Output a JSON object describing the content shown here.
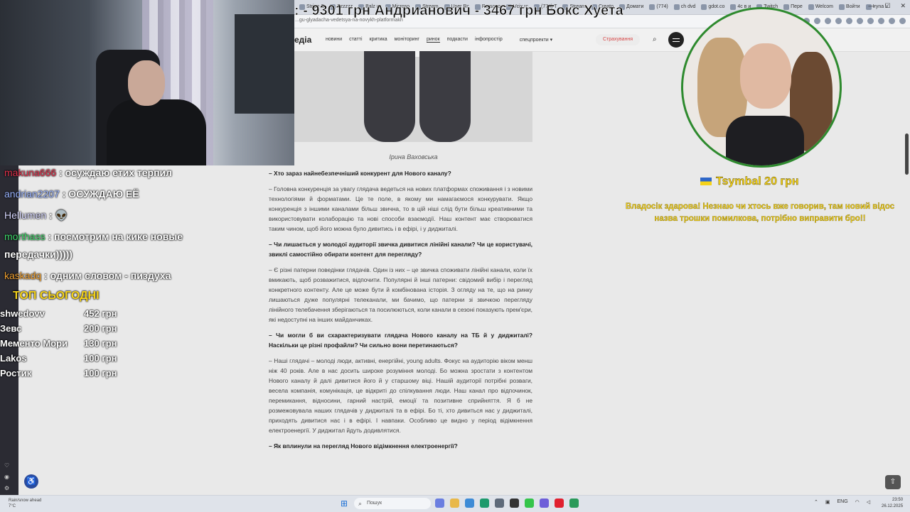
{
  "browser": {
    "tabs": [
      "Stripe C",
      "Zzzzzz",
      "Balz и",
      "Microso",
      "Stream",
      "User Rc",
      "Persono",
      "Vcix rc",
      "(774) T",
      "Stream",
      "Creato",
      "Домати",
      "(774)",
      "ch dvd",
      "gdot.co",
      "4с в и",
      "Twitch",
      "Пере",
      "Welcom",
      "Войти",
      "Iryna V"
    ],
    "url": "...gu-glyadacha-vedetsya-na-novykh-platformakh"
  },
  "site": {
    "logo": "едіа",
    "nav": [
      "новини",
      "статті",
      "критика",
      "моніторинг",
      "ринок",
      "подкасти",
      "інфопростір",
      "спецпроекти ▾"
    ],
    "active_nav": "ринок",
    "insurance_label": "Страхування",
    "search_icon": "⌕"
  },
  "article": {
    "caption": "Ірина Ваховська",
    "paragraphs": [
      {
        "type": "q",
        "text": "– Хто зараз найнебезпечніший конкурент для Нового каналу?"
      },
      {
        "type": "a",
        "text": "– Головна конкуренція за увагу глядача ведеться на нових платформах споживання і з новими технологіями й форматами. Це те поле, в якому ми намагаємося конкурувати. Якщо конкуренція з іншими каналами більш звична, то в цій ніші слід бути більш креативними та використовувати колаборацію та нові способи взаємодії. Наш контент має створюватися таким чином, щоб його можна було дивитись і в ефірі, і у диджиталі."
      },
      {
        "type": "q",
        "text": "– Чи лишається у молодої аудиторії звичка дивитися лінійні канали? Чи це користувачі, звиклі самостійно обирати контент для перегляду?"
      },
      {
        "type": "a",
        "text": "– Є різні патерни поведінки глядачів. Один із них – це звичка споживати лінійні канали, коли їх вмикають, щоб розважитися, відпочити. Популярні й інші патерни: свідомий вибір і перегляд конкретного контенту. Але це може бути й комбінована історія. З огляду на те, що на ринку лишаються дуже популярні телеканали, ми бачимо, що патерни зі звичкою перегляду лінійного телебачення зберігаються та посилюються, коли канали в сезоні показують прем'єри, які недоступні на інших майданчиках."
      },
      {
        "type": "q",
        "text": "– Чи могли б ви схарактеризувати глядача Нового каналу на ТБ й у диджиталі? Наскільки це різні профайли? Чи сильно вони перетинаються?"
      },
      {
        "type": "a",
        "text": "– Наші глядачі – молоді люди, активні, енергійні, young adults. Фокус на аудиторію віком менш ніж 40 років. Але в нас досить широке розуміння молоді. Бо можна зростати з контентом Нового каналу й далі дивитися його й у старшому віці. Нашій аудиторії потрібні розваги, весела компанія, комунікація, це відкриті до спілкування люди. Наш канал про відпочинок, перемикання, відносини, гарний настрій, емоції та позитивне сприйняття. Я б не розмежовувала наших глядачів у диджиталі та в ефірі. Бо ті, хто дивиться нас у диджиталі, приходять дивитися нас і в ефірі. І навпаки. Особливо це видно у період відімкнення електроенергії. У диджитал йдуть додивлятися."
      },
      {
        "type": "q",
        "text": "– Як вплинули на перегляд Нового відімкнення електроенергії?"
      }
    ]
  },
  "overlay": {
    "banner": ": - 9301 грн   Андрианович - 3467 грн   Бокс Хуета",
    "alert_name": "Tsymbal 20 грн",
    "alert_message": "Владосік здарова! Незнаю чи хтось вже говорив, там новий відос назва трошки помилкова, потрібно виправити бро!!",
    "chat": [
      {
        "user": "makuna666",
        "text": ": осуждаю етих терпил",
        "color": "#e0304a"
      },
      {
        "user": "andrian2207",
        "text": ": ОСУЖДАЮ ЕЁ",
        "color": "#9ab4ff"
      },
      {
        "user": "Hellumen",
        "text": ": 👽",
        "color": "#d8d8ff"
      },
      {
        "user": "morthass",
        "text": ": посмотрим на кике новые",
        "color": "#3ed86a"
      },
      {
        "user": "",
        "text": "передачки)))))",
        "color": "#ffffff"
      },
      {
        "user": "kaskadq",
        "text": ": одним словом - пиздуха",
        "color": "#f0a030"
      }
    ],
    "top_title": "ТОП СЬОГОДНІ",
    "top_list": [
      {
        "name": "shwedovv",
        "amount": "452 грн"
      },
      {
        "name": "Зевс",
        "amount": "200 грн"
      },
      {
        "name": "Мементо Мори",
        "amount": "130 грн"
      },
      {
        "name": "Lakos",
        "amount": "100 грн"
      },
      {
        "name": "Ростик",
        "amount": "100 грн"
      }
    ]
  },
  "taskbar": {
    "weather_line1": "Rain/snow ahead",
    "weather_line2": "7°C",
    "search_placeholder": "Пошук",
    "lang": "ENG",
    "time": "23:50",
    "date": "26.12.2025"
  }
}
